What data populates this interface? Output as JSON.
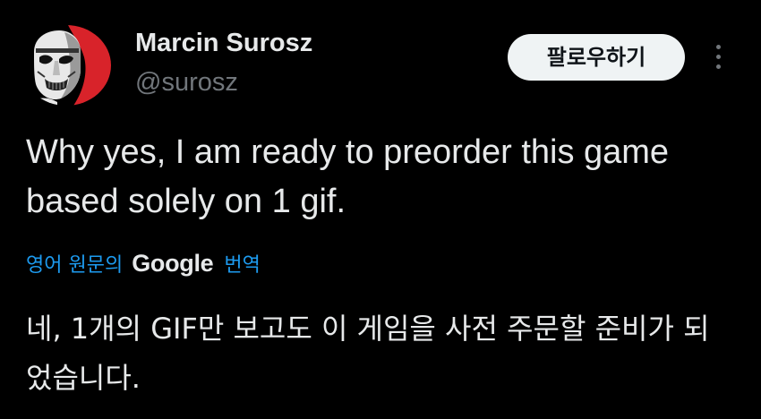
{
  "author": {
    "name": "Marcin Surosz",
    "handle": "@surosz"
  },
  "actions": {
    "follow_label": "팔로우하기",
    "more_icon": "more-vertical-icon"
  },
  "tweet": {
    "text": "Why yes, I am ready to preorder this game based solely on 1 gif."
  },
  "translation": {
    "prefix": "영어 원문의",
    "provider": "Google",
    "suffix": "번역",
    "text": "네, 1개의 GIF만 보고도 이 게임을 사전 주문할 준비가 되었습니다."
  },
  "colors": {
    "background": "#000000",
    "primary_text": "#e7e9ea",
    "secondary_text": "#71767b",
    "link": "#1d9bf0",
    "avatar_red": "#d8232a",
    "button_bg": "#eff3f4"
  }
}
